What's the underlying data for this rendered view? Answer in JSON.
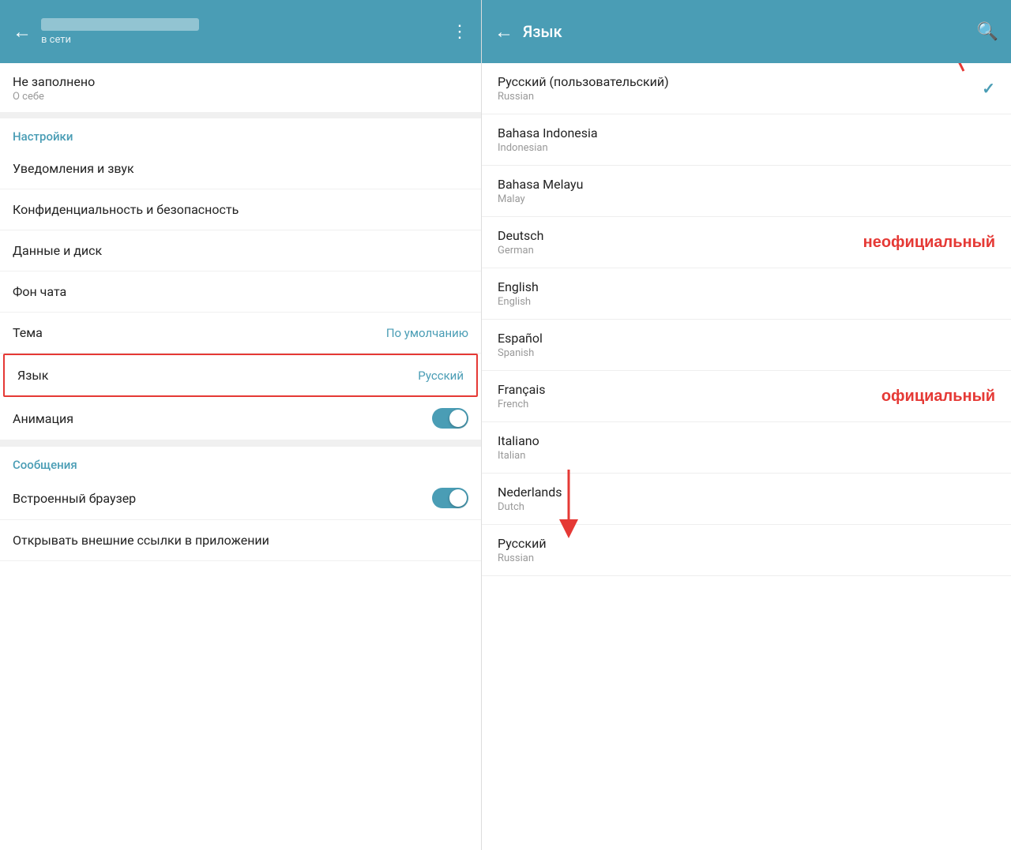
{
  "left": {
    "header": {
      "back_label": "←",
      "status": "в сети",
      "dots_label": "⋮"
    },
    "not_filled": {
      "title": "Не заполнено",
      "subtitle": "О себе"
    },
    "settings_section": "Настройки",
    "menu_items": [
      {
        "label": "Уведомления и звук",
        "value": ""
      },
      {
        "label": "Конфиденциальность и безопасность",
        "value": ""
      },
      {
        "label": "Данные и диск",
        "value": ""
      },
      {
        "label": "Фон чата",
        "value": ""
      },
      {
        "label": "Тема",
        "value": "По умолчанию"
      },
      {
        "label": "Язык",
        "value": "Русский"
      },
      {
        "label": "Анимация",
        "value": "toggle"
      }
    ],
    "messages_section": "Сообщения",
    "messages_items": [
      {
        "label": "Встроенный браузер",
        "value": "toggle"
      },
      {
        "label": "Открывать внешние ссылки в приложении",
        "value": ""
      }
    ]
  },
  "right": {
    "header": {
      "back_label": "←",
      "title": "Язык",
      "search_label": "🔍"
    },
    "languages": [
      {
        "name": "Русский (пользовательский)",
        "sub": "Russian",
        "checked": true,
        "annotation": ""
      },
      {
        "name": "Bahasa Indonesia",
        "sub": "Indonesian",
        "checked": false,
        "annotation": ""
      },
      {
        "name": "Bahasa Melayu",
        "sub": "Malay",
        "checked": false,
        "annotation": ""
      },
      {
        "name": "Deutsch",
        "sub": "German",
        "checked": false,
        "annotation": "неофициальный"
      },
      {
        "name": "English",
        "sub": "English",
        "checked": false,
        "annotation": ""
      },
      {
        "name": "Español",
        "sub": "Spanish",
        "checked": false,
        "annotation": ""
      },
      {
        "name": "Français",
        "sub": "French",
        "checked": false,
        "annotation": "официальный"
      },
      {
        "name": "Italiano",
        "sub": "Italian",
        "checked": false,
        "annotation": ""
      },
      {
        "name": "Nederlands",
        "sub": "Dutch",
        "checked": false,
        "annotation": ""
      },
      {
        "name": "Русский",
        "sub": "Russian",
        "checked": false,
        "annotation": ""
      }
    ]
  }
}
